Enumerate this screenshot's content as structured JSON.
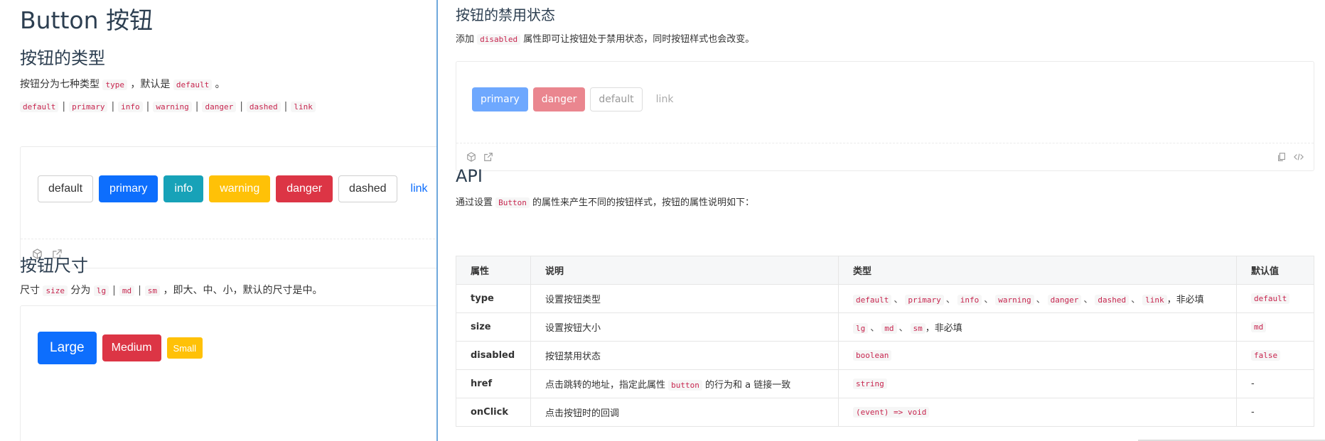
{
  "left": {
    "title": "Button 按钮",
    "types_section": {
      "heading": "按钮的类型",
      "desc_before": "按钮分为七种类型",
      "desc_code": "type",
      "desc_mid": "，默认是",
      "desc_code2": "default",
      "desc_end": "。",
      "type_codes": [
        "default",
        "primary",
        "info",
        "warning",
        "danger",
        "dashed",
        "link"
      ],
      "buttons": [
        "default",
        "primary",
        "info",
        "warning",
        "danger",
        "dashed",
        "link"
      ]
    },
    "size_section": {
      "heading": "按钮尺寸",
      "desc_before": "尺寸",
      "desc_code": "size",
      "desc_mid": "分为",
      "sizes": [
        "lg",
        "md",
        "sm"
      ],
      "desc_end": "，即大、中、小，默认的尺寸是中。",
      "buttons": [
        "Large",
        "Medium",
        "Small"
      ]
    }
  },
  "right": {
    "disabled_section": {
      "heading": "按钮的禁用状态",
      "desc_before": "添加",
      "desc_code": "disabled",
      "desc_after": "属性即可让按钮处于禁用状态，同时按钮样式也会改变。",
      "buttons": [
        "primary",
        "danger",
        "default",
        "link"
      ]
    },
    "api_section": {
      "heading": "API",
      "desc_before": "通过设置",
      "desc_code": "Button",
      "desc_after": "的属性来产生不同的按钮样式，按钮的属性说明如下："
    },
    "table": {
      "headers": [
        "属性",
        "说明",
        "类型",
        "默认值"
      ],
      "rows": [
        {
          "prop": "type",
          "desc": "设置按钮类型",
          "default": "default"
        },
        {
          "prop": "size",
          "desc": "设置按钮大小",
          "default": "md"
        },
        {
          "prop": "disabled",
          "desc": "按钮禁用状态",
          "type_code": "boolean",
          "default": "false"
        },
        {
          "prop": "href",
          "desc_before": "点击跳转的地址，指定此属性",
          "desc_code": "button",
          "desc_after": "的行为和 a 链接一致",
          "type_code": "string",
          "default": "-"
        },
        {
          "prop": "onClick",
          "desc": "点击按钮时的回调",
          "type_code": "(event) => void",
          "default": "-"
        }
      ],
      "type_row_codes": [
        "default",
        "primary",
        "info",
        "warning",
        "danger",
        "dashed",
        "link"
      ],
      "type_row_suffix": "，非必填",
      "size_row_codes": [
        "lg",
        "md",
        "sm"
      ],
      "size_row_suffix": "，非必填"
    }
  }
}
